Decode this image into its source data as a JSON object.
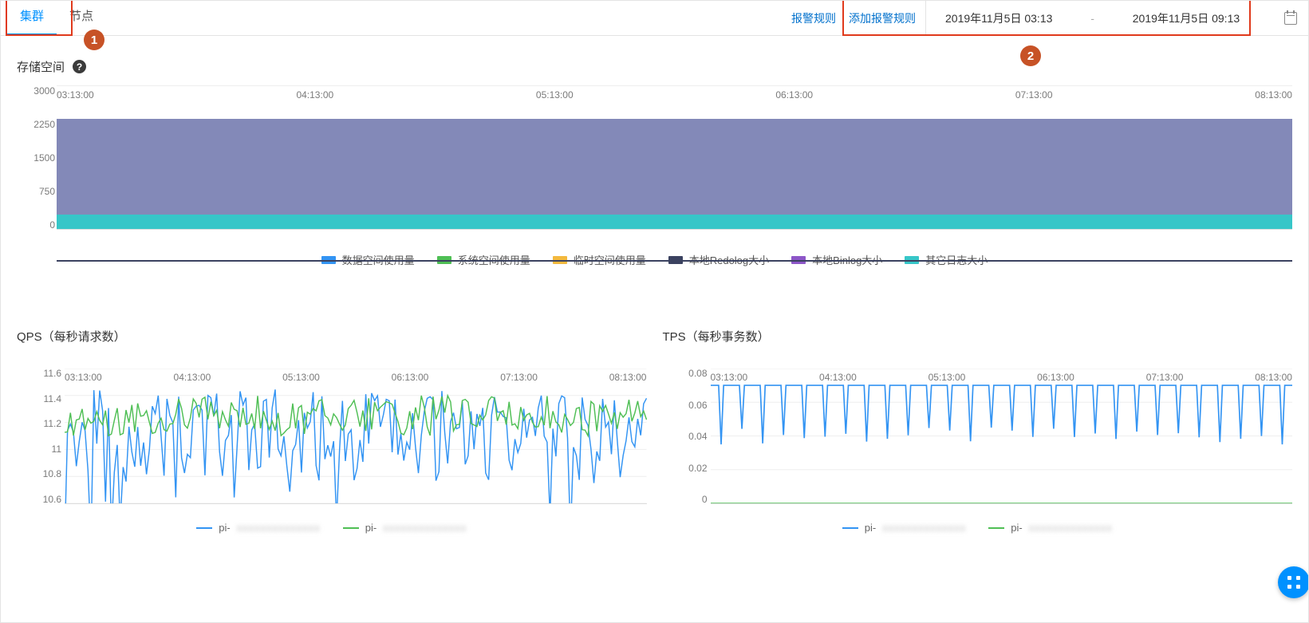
{
  "tabs": {
    "cluster": "集群",
    "node": "节点",
    "active": "cluster"
  },
  "header_links": {
    "alarm_rules": "报警规则",
    "add_alarm_rule": "添加报警规则"
  },
  "date_range": {
    "from": "2019年11月5日 03:13",
    "to": "2019年11月5日 09:13"
  },
  "annotations": {
    "badge1": "1",
    "badge2": "2"
  },
  "section_storage_title": "存储空间",
  "storage_legend": {
    "data_space": "数据空间使用量",
    "system_space": "系统空间使用量",
    "temp_space": "临时空间使用量",
    "local_redolog": "本地Redolog大小",
    "local_binlog": "本地Binlog大小",
    "other_log": "其它日志大小"
  },
  "chart_data": [
    {
      "id": "storage",
      "type": "area",
      "title": "存储空间",
      "xlabel": "",
      "ylabel": "",
      "ylim": [
        0,
        3000
      ],
      "x_categories": [
        "03:13:00",
        "04:13:00",
        "05:13:00",
        "06:13:00",
        "07:13:00",
        "08:13:00"
      ],
      "y_ticks": [
        0,
        750,
        1500,
        2250,
        3000
      ],
      "series": [
        {
          "name": "数据空间使用量",
          "color": "#3394f3",
          "values": [
            0,
            0,
            0,
            0,
            0,
            0
          ]
        },
        {
          "name": "系统空间使用量",
          "color": "#4fbf55",
          "values": [
            0,
            0,
            0,
            0,
            0,
            0
          ]
        },
        {
          "name": "临时空间使用量",
          "color": "#f3b93e",
          "values": [
            0,
            0,
            0,
            0,
            0,
            0
          ]
        },
        {
          "name": "本地Redolog大小",
          "color": "#3b4260",
          "values": [
            2320,
            2320,
            2320,
            2320,
            2320,
            2320
          ]
        },
        {
          "name": "本地Binlog大小",
          "color": "#8d57c8",
          "values": [
            0,
            0,
            0,
            0,
            0,
            0
          ]
        },
        {
          "name": "其它日志大小",
          "color": "#37c6c8",
          "values": [
            300,
            300,
            300,
            300,
            300,
            300
          ]
        }
      ],
      "stack_visible_layers": [
        {
          "name": "其它日志大小",
          "approx_value": 300
        },
        {
          "name": "本地Redolog大小",
          "approx_value": 2000
        }
      ]
    },
    {
      "id": "qps",
      "type": "line",
      "title": "QPS（每秒请求数）",
      "xlabel": "",
      "ylabel": "",
      "ylim": [
        10.6,
        11.6
      ],
      "x_categories": [
        "03:13:00",
        "04:13:00",
        "05:13:00",
        "06:13:00",
        "07:13:00",
        "08:13:00"
      ],
      "y_ticks": [
        10.6,
        10.8,
        11.0,
        11.2,
        11.4,
        11.6
      ],
      "series": [
        {
          "name": "pi-…主节点",
          "legend_label": "pi-",
          "color": "#3394f3",
          "approx_mean": 11.1,
          "approx_range": [
            10.75,
            11.45
          ]
        },
        {
          "name": "pi-…只读节点",
          "legend_label": "pi-",
          "color": "#4fbf55",
          "approx_mean": 11.25,
          "approx_range": [
            11.05,
            11.35
          ]
        }
      ]
    },
    {
      "id": "tps",
      "type": "line",
      "title": "TPS（每秒事务数）",
      "xlabel": "",
      "ylabel": "",
      "ylim": [
        0,
        0.08
      ],
      "x_categories": [
        "03:13:00",
        "04:13:00",
        "05:13:00",
        "06:13:00",
        "07:13:00",
        "08:13:00"
      ],
      "y_ticks": [
        0,
        0.02,
        0.04,
        0.06,
        0.08
      ],
      "series": [
        {
          "name": "pi-…主节点",
          "legend_label": "pi-",
          "color": "#3394f3",
          "baseline": 0.07,
          "dip_to": 0.035,
          "dip_count_approx": 28
        },
        {
          "name": "pi-…只读节点",
          "legend_label": "pi-",
          "color": "#4fbf55",
          "constant": 0.0
        }
      ]
    }
  ],
  "legend_series": {
    "s1": "pi-",
    "s2": "pi-"
  }
}
